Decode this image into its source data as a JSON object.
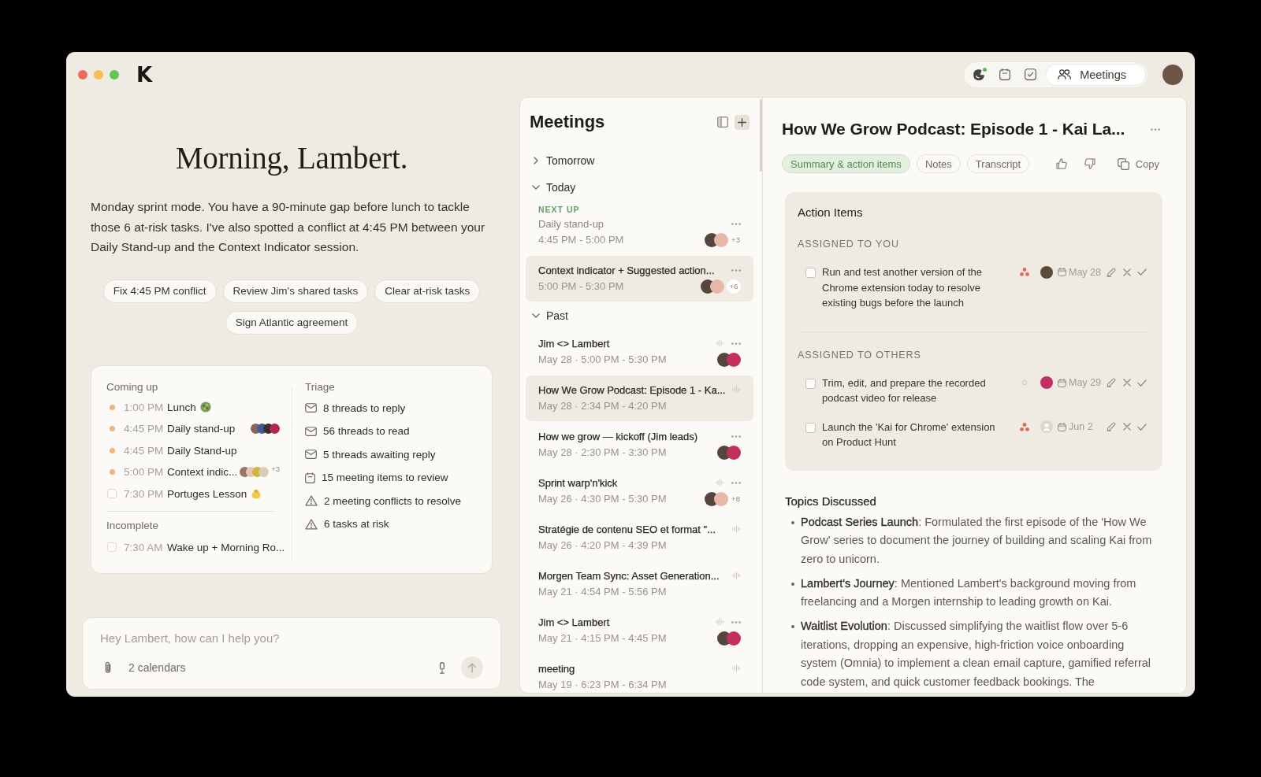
{
  "window": {
    "logo": "K"
  },
  "nav": {
    "tabs": [
      {
        "selected": false,
        "dot": true
      },
      {
        "selected": false,
        "dot": false
      },
      {
        "selected": false,
        "dot": false
      },
      {
        "label": "Meetings",
        "selected": true,
        "dot": false
      }
    ]
  },
  "home": {
    "greeting": "Morning, Lambert.",
    "summary": "Monday sprint mode. You have a 90-minute gap before lunch to tackle those 6 at-risk tasks. I've also spotted a conflict at 4:45 PM between your Daily Stand-up and the Context Indicator session.",
    "suggestions": [
      "Fix 4:45 PM conflict",
      "Review Jim's shared tasks",
      "Clear at-risk tasks",
      "Sign Atlantic agreement"
    ],
    "coming_up": {
      "title": "Coming up",
      "items": [
        {
          "kind": "event",
          "time": "1:00 PM",
          "title": "Lunch"
        },
        {
          "kind": "event",
          "time": "4:45 PM",
          "title": "Daily stand-up",
          "avatars": [
            {
              "color": "#8a6457"
            },
            {
              "color": "#3d5a9c"
            },
            {
              "color": "#3a2d2a"
            },
            {
              "color": "#b3264e"
            }
          ]
        },
        {
          "kind": "event",
          "time": "4:45 PM",
          "title": "Daily Stand-up"
        },
        {
          "kind": "event",
          "time": "5:00 PM",
          "title": "Context indic...",
          "avatars": [
            {
              "color": "#9b7565"
            },
            {
              "color": "#e5c3b8"
            },
            {
              "color": "#d1b23d"
            },
            {
              "color": "#dccbb8"
            }
          ],
          "more": "+3"
        },
        {
          "kind": "task",
          "checked": false,
          "time": "7:30 PM",
          "title": "Portuges Lesson"
        }
      ]
    },
    "incomplete": {
      "title": "Incomplete",
      "items": [
        {
          "kind": "task",
          "checked": false,
          "time": "7:30 AM",
          "title": "Wake up + Morning Ro..."
        }
      ]
    },
    "triage": {
      "title": "Triage",
      "items": [
        {
          "kind": "thread",
          "label": "8 threads to reply"
        },
        {
          "kind": "thread",
          "label": "56 threads to read"
        },
        {
          "kind": "thread",
          "label": "5 threads awaiting reply"
        },
        {
          "kind": "meeting",
          "label": "15 meeting items to review"
        },
        {
          "kind": "risk",
          "label": "2 meeting conflicts to resolve"
        },
        {
          "kind": "risk",
          "label": "6 tasks at risk"
        }
      ]
    },
    "composer": {
      "placeholder": "Hey Lambert, how can I help you?",
      "calendars": "2 calendars"
    }
  },
  "meetings": {
    "title": "Meetings",
    "sections": [
      {
        "label": "Tomorrow",
        "expanded": false
      },
      {
        "label": "Today",
        "expanded": true,
        "items": [
          {
            "tag": "NEXT UP",
            "title": "Daily stand-up",
            "when": "4:45 PM - 5:00 PM",
            "selected": false,
            "dimmed": true,
            "recorded": false,
            "avatars": [
              {
                "color": "#55463d"
              },
              {
                "color": "#e7b8a8"
              }
            ],
            "more": "+3"
          },
          {
            "title": "Context indicator + Suggested action...",
            "when": "5:00 PM - 5:30 PM",
            "selected": true,
            "dimmed": false,
            "recorded": false,
            "avatars": [
              {
                "color": "#55463d"
              },
              {
                "color": "#e7b8a8"
              }
            ],
            "more": "+6"
          }
        ]
      },
      {
        "label": "Past",
        "expanded": true,
        "items": [
          {
            "title": "Jim <> Lambert",
            "when": "May 28 · 5:00 PM - 5:30 PM",
            "selected": false,
            "dimmed": false,
            "recorded": true,
            "avatars": [
              {
                "color": "#55463d"
              },
              {
                "color": "#c2305f"
              }
            ]
          },
          {
            "title": "How We Grow Podcast: Episode 1 - Ka...",
            "when": "May 28 · 2:34 PM - 4:20 PM",
            "selected": true,
            "dimmed": false,
            "recorded": true
          },
          {
            "title": "How we grow — kickoff (Jim leads)",
            "when": "May 28 · 2:30 PM - 3:30 PM",
            "selected": false,
            "dimmed": false,
            "recorded": false,
            "avatars": [
              {
                "color": "#55463d"
              },
              {
                "color": "#c2305f"
              }
            ]
          },
          {
            "title": "Sprint warp'n'kick",
            "when": "May 26 · 4:30 PM - 5:30 PM",
            "selected": false,
            "dimmed": false,
            "recorded": true,
            "avatars": [
              {
                "color": "#55463d"
              },
              {
                "color": "#e7b8a8"
              }
            ],
            "more": "+8"
          },
          {
            "title": "Stratégie de contenu SEO et format \"...",
            "when": "May 26 · 4:20 PM - 4:39 PM",
            "selected": false,
            "dimmed": false,
            "recorded": true
          },
          {
            "title": "Morgen Team Sync: Asset Generation...",
            "when": "May 21 · 4:54 PM - 5:56 PM",
            "selected": false,
            "dimmed": false,
            "recorded": true
          },
          {
            "title": "Jim <> Lambert",
            "when": "May 21 · 4:15 PM - 4:45 PM",
            "selected": false,
            "dimmed": false,
            "recorded": true,
            "avatars": [
              {
                "color": "#55463d"
              },
              {
                "color": "#c2305f"
              }
            ]
          },
          {
            "title": "meeting",
            "when": "May 19 · 6:23 PM - 6:34 PM",
            "selected": false,
            "dimmed": false,
            "recorded": true
          }
        ]
      }
    ]
  },
  "detail": {
    "title": "How We Grow Podcast: Episode 1 - Kai La...",
    "tabs": [
      {
        "label": "Summary & action items",
        "selected": true
      },
      {
        "label": "Notes",
        "selected": false
      },
      {
        "label": "Transcript",
        "selected": false
      }
    ],
    "copy": "Copy",
    "action_items": {
      "title": "Action Items",
      "groups": [
        {
          "label": "ASSIGNED TO YOU",
          "items": [
            {
              "text": "Run and test another version of the Chrome extension today to resolve existing bugs before the launch",
              "checked": false,
              "linked": true,
              "assignee": {
                "kind": "photo"
              },
              "due": "May 28"
            }
          ]
        },
        {
          "label": "ASSIGNED TO OTHERS",
          "items": [
            {
              "text": "Trim, edit, and prepare the recorded podcast video for release",
              "checked": false,
              "linked": false,
              "assignee": {
                "kind": "member"
              },
              "due": "May 29"
            },
            {
              "text": "Launch the 'Kai for Chrome' extension on Product Hunt",
              "checked": false,
              "linked": true,
              "assignee": {
                "kind": "unassigned"
              },
              "due": "Jun 2"
            }
          ]
        }
      ]
    },
    "topics": {
      "title": "Topics Discussed",
      "items": [
        "**Podcast Series Launch**: Formulated the first episode of the 'How We Grow' series to document the journey of building and scaling Kai from zero to unicorn.",
        "**Lambert's Journey**: Mentioned Lambert's background moving from freelancing and a Morgen internship to leading growth on Kai.",
        "**Waitlist Evolution**: Discussed simplifying the waitlist flow over 5-6 iterations, dropping an expensive, high-friction voice onboarding system (Omnia) to implement a clean email capture, gamified referral code system, and quick customer feedback bookings. The"
      ]
    }
  }
}
